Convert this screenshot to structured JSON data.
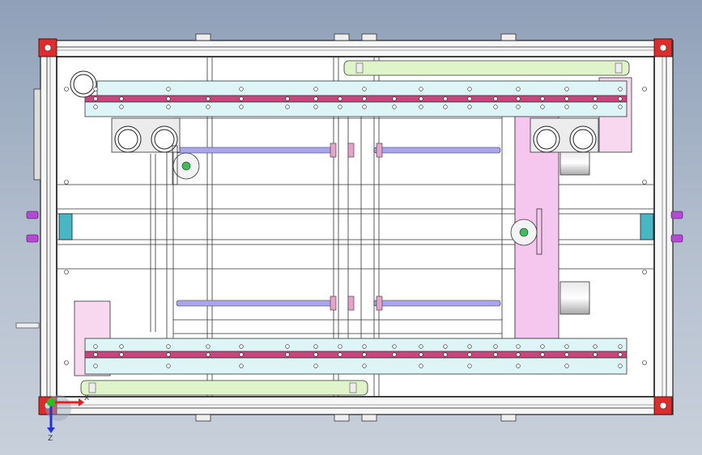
{
  "viewport": {
    "background_top": "#8fa0b8",
    "background_bottom": "#c8d0db"
  },
  "triad": {
    "x_label": "X",
    "z_label": "Z",
    "x_color": "#e02020",
    "y_color": "#20c020",
    "z_color": "#2030e0"
  },
  "colors": {
    "rail_cyan": "#def5f7",
    "belt_magenta": "#c8457d",
    "guide_green": "#dff5c9",
    "pink_panel": "#f5c6ee",
    "shaft_purple": "#a9a6ee",
    "clamp_purple": "#b34bd1",
    "corner_red": "#e12a2a",
    "teal_block": "#48b7c4"
  }
}
